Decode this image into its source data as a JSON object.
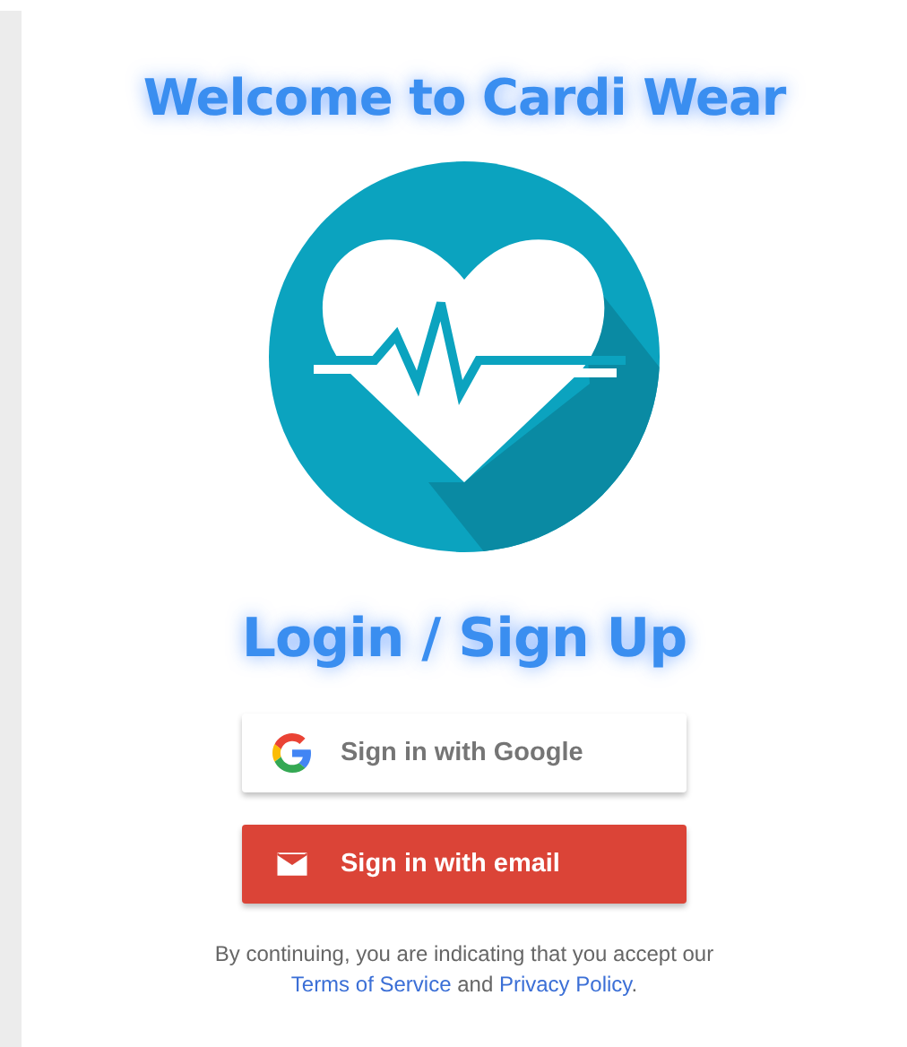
{
  "title": "Welcome to Cardi Wear",
  "heading": "Login / Sign Up",
  "buttons": [
    {
      "kind": "google",
      "label": "Sign in with Google"
    },
    {
      "kind": "email",
      "label": "Sign in with email"
    }
  ],
  "legal": {
    "prefix": "By continuing, you are indicating that you accept our",
    "terms_link": "Terms of Service",
    "conjunction": "and",
    "privacy_link": "Privacy Policy",
    "suffix": "."
  }
}
